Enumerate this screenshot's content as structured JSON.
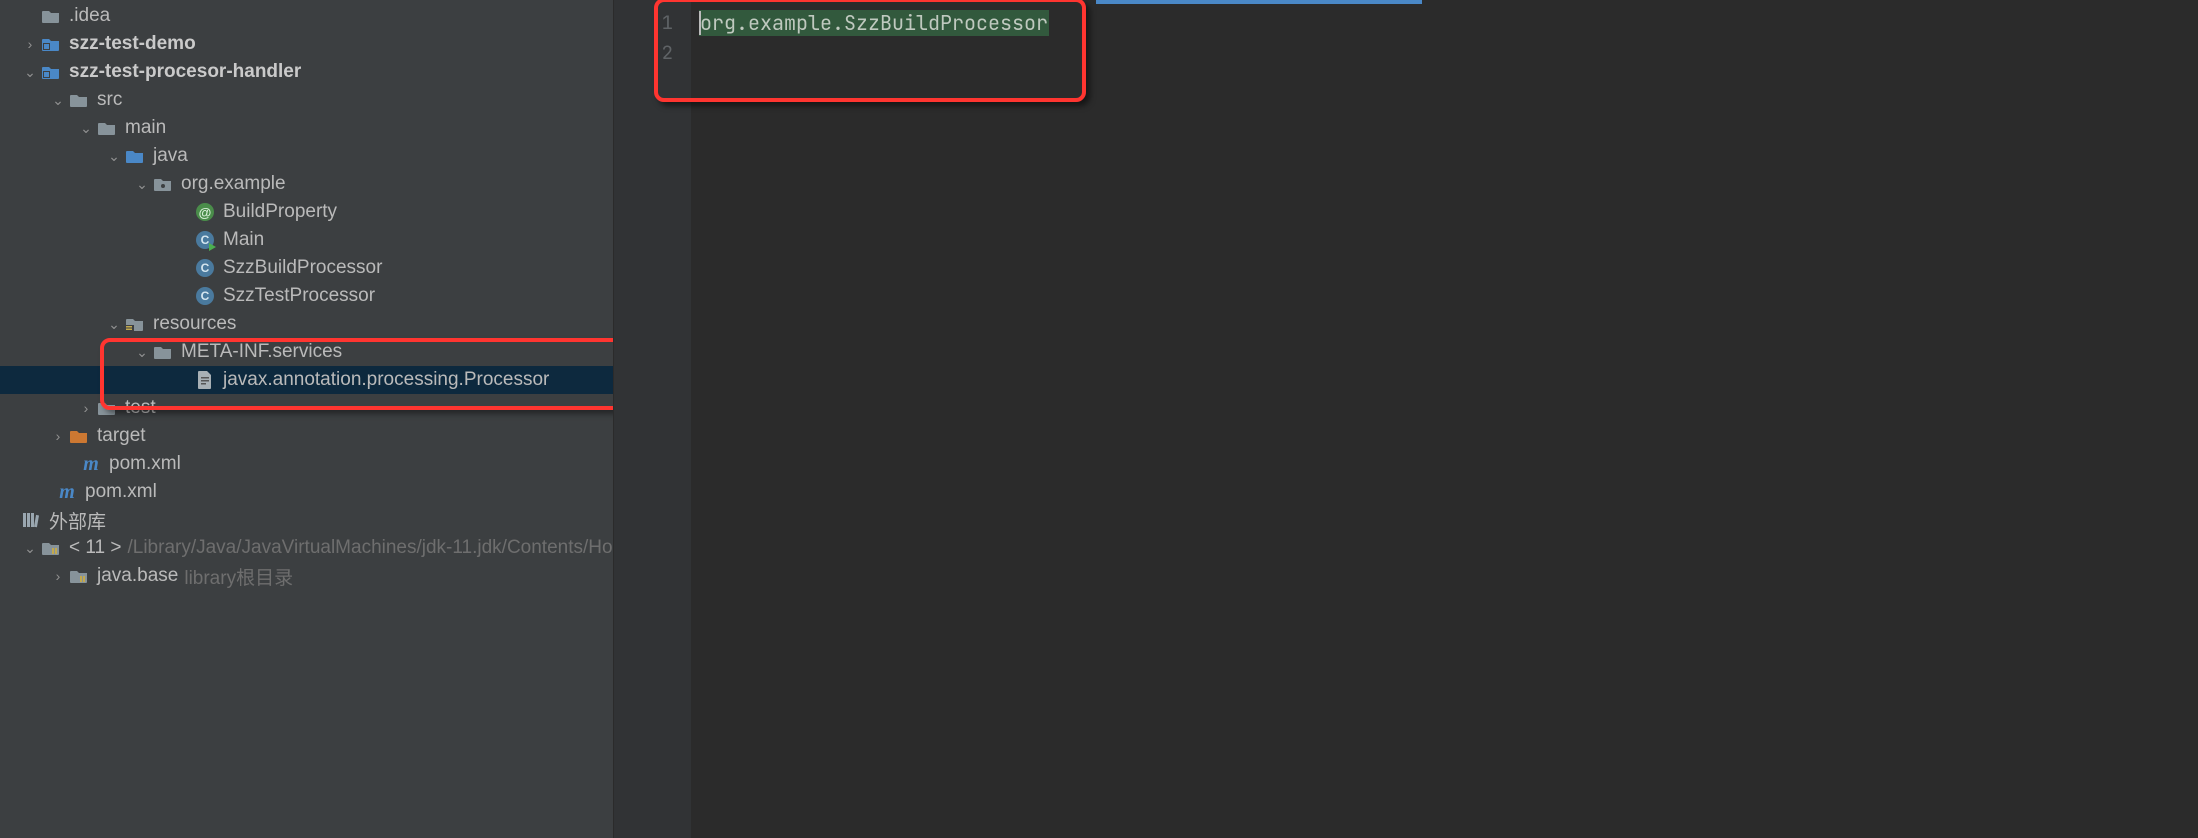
{
  "tree": {
    "items": [
      {
        "indent": 20,
        "twisty": "",
        "iconType": "folder-gray",
        "label": ".idea",
        "bold": false
      },
      {
        "indent": 20,
        "twisty": "›",
        "iconType": "module",
        "label": "szz-test-demo",
        "bold": true
      },
      {
        "indent": 20,
        "twisty": "⌄",
        "iconType": "module",
        "label": "szz-test-procesor-handler",
        "bold": true
      },
      {
        "indent": 48,
        "twisty": "⌄",
        "iconType": "folder-gray",
        "label": "src",
        "bold": false
      },
      {
        "indent": 76,
        "twisty": "⌄",
        "iconType": "folder-gray",
        "label": "main",
        "bold": false
      },
      {
        "indent": 104,
        "twisty": "⌄",
        "iconType": "folder-src",
        "label": "java",
        "bold": false
      },
      {
        "indent": 132,
        "twisty": "⌄",
        "iconType": "package",
        "label": "org.example",
        "bold": false
      },
      {
        "indent": 174,
        "twisty": "",
        "iconType": "interface",
        "iconLetter": "@",
        "label": "BuildProperty",
        "bold": false
      },
      {
        "indent": 174,
        "twisty": "",
        "iconType": "runclass",
        "label": "Main",
        "bold": false
      },
      {
        "indent": 174,
        "twisty": "",
        "iconType": "class",
        "iconLetter": "C",
        "label": "SzzBuildProcessor",
        "bold": false
      },
      {
        "indent": 174,
        "twisty": "",
        "iconType": "class",
        "iconLetter": "C",
        "label": "SzzTestProcessor",
        "bold": false
      },
      {
        "indent": 104,
        "twisty": "⌄",
        "iconType": "folder-res",
        "label": "resources",
        "bold": false
      },
      {
        "indent": 132,
        "twisty": "⌄",
        "iconType": "folder-gray",
        "label": "META-INF.services",
        "bold": false
      },
      {
        "indent": 174,
        "twisty": "",
        "iconType": "file",
        "label": "javax.annotation.processing.Processor",
        "bold": false,
        "selected": true
      },
      {
        "indent": 76,
        "twisty": "›",
        "iconType": "folder-gray",
        "label": "test",
        "bold": false
      },
      {
        "indent": 48,
        "twisty": "›",
        "iconType": "folder-target",
        "label": "target",
        "bold": false
      },
      {
        "indent": 60,
        "twisty": "",
        "iconType": "maven",
        "label": "pom.xml",
        "bold": false
      },
      {
        "indent": 36,
        "twisty": "",
        "iconType": "maven",
        "label": "pom.xml",
        "bold": false
      },
      {
        "indent": 0,
        "twisty": "",
        "iconType": "lib",
        "label": "外部库",
        "bold": false,
        "noicon": false
      },
      {
        "indent": 20,
        "twisty": "⌄",
        "iconType": "folder-lib",
        "label": "< 11 >",
        "bold": false,
        "suffix": "/Library/Java/JavaVirtualMachines/jdk-11.jdk/Contents/Ho"
      },
      {
        "indent": 48,
        "twisty": "›",
        "iconType": "folder-lib",
        "label": "java.base",
        "bold": false,
        "suffix": "library根目录"
      }
    ]
  },
  "editor": {
    "gutter": [
      "1",
      "2"
    ],
    "line1": "org.example.SzzBuildProcessor"
  }
}
